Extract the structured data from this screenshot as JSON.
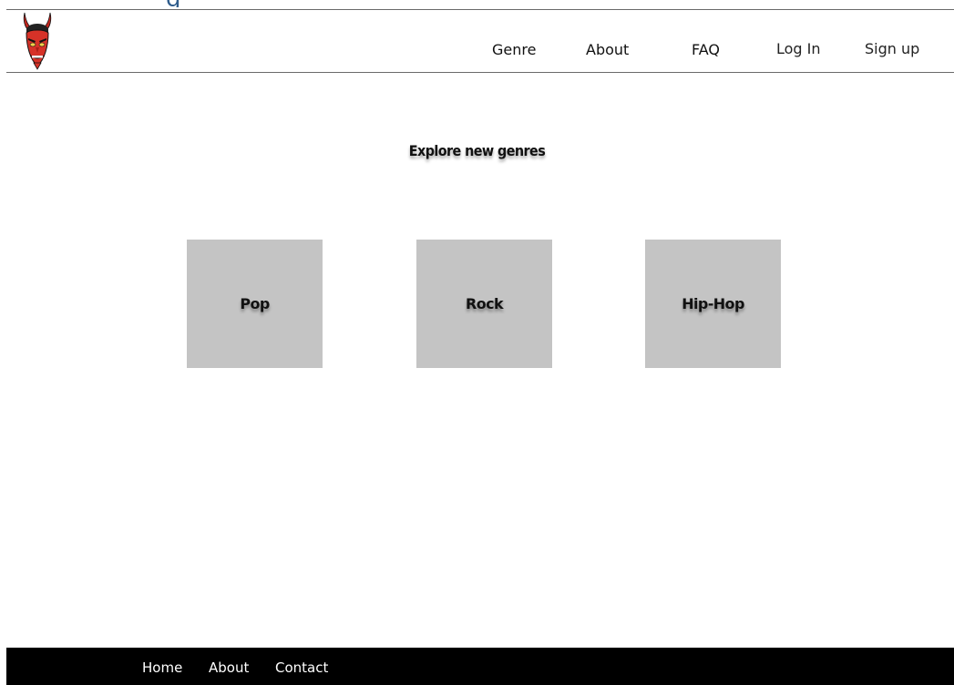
{
  "header_fragment": "g",
  "nav": {
    "logo_icon": "demon-mask-icon",
    "items": [
      {
        "label": "Genre"
      },
      {
        "label": "About"
      },
      {
        "label": "FAQ"
      },
      {
        "label": "Log In"
      },
      {
        "label": "Sign up"
      }
    ]
  },
  "main": {
    "title": "Explore new genres",
    "genres": [
      {
        "label": "Pop"
      },
      {
        "label": "Rock"
      },
      {
        "label": "Hip-Hop"
      }
    ],
    "card_color": "#c4c4c4"
  },
  "footer": {
    "links": [
      {
        "label": "Home"
      },
      {
        "label": "About"
      },
      {
        "label": "Contact"
      }
    ],
    "background": "#000000"
  }
}
